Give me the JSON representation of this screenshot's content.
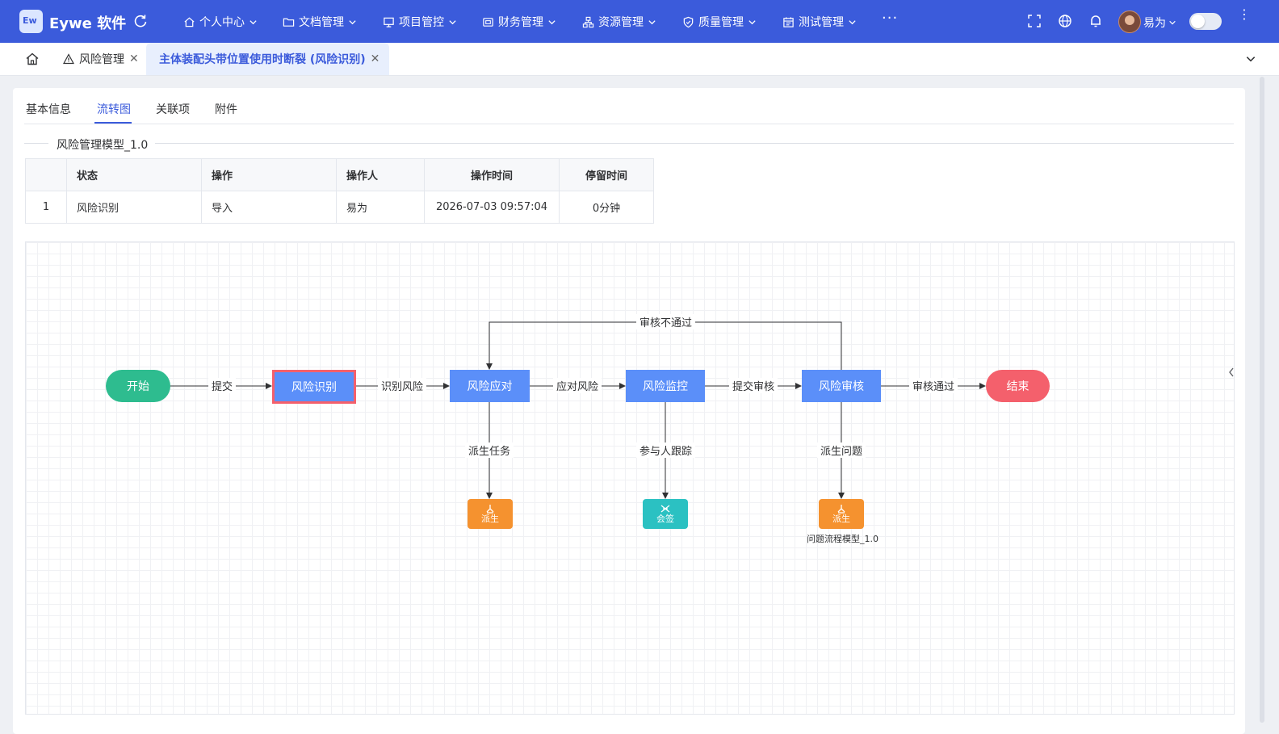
{
  "app": {
    "logo_text": "Ew",
    "title": "Eywe 软件"
  },
  "nav": [
    {
      "label": "个人中心",
      "icon": "home-icon"
    },
    {
      "label": "文档管理",
      "icon": "folder-icon"
    },
    {
      "label": "项目管控",
      "icon": "monitor-icon"
    },
    {
      "label": "财务管理",
      "icon": "finance-icon"
    },
    {
      "label": "资源管理",
      "icon": "resource-icon"
    },
    {
      "label": "质量管理",
      "icon": "shield-icon"
    },
    {
      "label": "测试管理",
      "icon": "calendar-icon"
    }
  ],
  "nav_more": "···",
  "user": {
    "name": "易为"
  },
  "tabs": {
    "risk_mgmt": "风险管理",
    "current": "主体装配头带位置使用时断裂 (风险识别)"
  },
  "detail_tabs": [
    "基本信息",
    "流转图",
    "关联项",
    "附件"
  ],
  "active_detail_tab": "流转图",
  "section_title": "风险管理模型_1.0",
  "log_table": {
    "headers": [
      "",
      "状态",
      "操作",
      "操作人",
      "操作时间",
      "停留时间"
    ],
    "rows": [
      [
        "1",
        "风险识别",
        "导入",
        "易为",
        "2026-07-03 09:57:04",
        "0分钟"
      ]
    ]
  },
  "flow": {
    "nodes": {
      "start": "开始",
      "identify": "风险识别",
      "respond": "风险应对",
      "monitor": "风险监控",
      "review": "风险审核",
      "end": "结束"
    },
    "edges": {
      "submit": "提交",
      "identify_risk": "识别风险",
      "respond_risk": "应对风险",
      "submit_review": "提交审核",
      "review_pass": "审核通过",
      "review_reject": "审核不通过",
      "derive_task": "派生任务",
      "participant_track": "参与人跟踪",
      "derive_issue": "派生问题"
    },
    "sub_nodes": {
      "derive1": "派生",
      "countersign": "会签",
      "derive2": "派生",
      "derive2_caption": "问题流程模型_1.0"
    },
    "colors": {
      "box": "#5b8ff9",
      "start": "#2ebc8f",
      "end": "#f4606c",
      "current_outline": "#f4606c",
      "derive": "#f5922f",
      "countersign": "#2bc1c2"
    }
  }
}
